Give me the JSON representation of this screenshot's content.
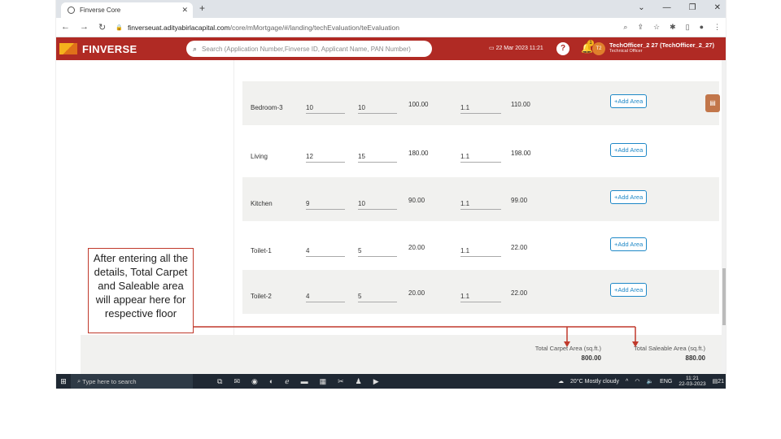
{
  "browser": {
    "tab_title": "Finverse Core",
    "url_host": "finverseuat.adityabirlacapital.com",
    "url_path": "/core/mMortgage/#/landing/techEvaluation/teEvaluation"
  },
  "header": {
    "brand": "FINVERSE",
    "search_placeholder": "Search (Application Number,Finverse ID, Applicant Name, PAN Number)",
    "date": "22 Mar 2023 11:21",
    "notification_count": "1",
    "avatar_initials": "T2",
    "user_name": "TechOfficer_2 27 (TechOfficer_2_27)",
    "user_role": "Technical Officer"
  },
  "rows": [
    {
      "name": "Bedroom-3",
      "length": "10",
      "width": "10",
      "area": "100.00",
      "factor": "1.1",
      "saleable": "110.00",
      "button": "+Add Area"
    },
    {
      "name": "Living",
      "length": "12",
      "width": "15",
      "area": "180.00",
      "factor": "1.1",
      "saleable": "198.00",
      "button": "+Add Area"
    },
    {
      "name": "Kitchen",
      "length": "9",
      "width": "10",
      "area": "90.00",
      "factor": "1.1",
      "saleable": "99.00",
      "button": "+Add Area"
    },
    {
      "name": "Toilet-1",
      "length": "4",
      "width": "5",
      "area": "20.00",
      "factor": "1.1",
      "saleable": "22.00",
      "button": "+Add Area"
    },
    {
      "name": "Toilet-2",
      "length": "4",
      "width": "5",
      "area": "20.00",
      "factor": "1.1",
      "saleable": "22.00",
      "button": "+Add Area"
    }
  ],
  "totals": {
    "carpet_label": "Total Carpet Area (sq.ft.)",
    "carpet_value": "800.00",
    "saleable_label": "Total Saleable Area (sq.ft.)",
    "saleable_value": "880.00"
  },
  "taskbar": {
    "search_placeholder": "Type here to search",
    "weather": "20°C  Mostly cloudy",
    "lang": "ENG",
    "time": "11:21",
    "date": "22-03-2023",
    "notif": "21"
  },
  "annotation": {
    "text": "After entering all the details, Total Carpet and Saleable area will appear here for respective floor",
    "color": "#c0392b"
  },
  "colors": {
    "header_bg": "#b02a24",
    "accent": "#1e88c7",
    "row_band": "#f1f1ef"
  }
}
